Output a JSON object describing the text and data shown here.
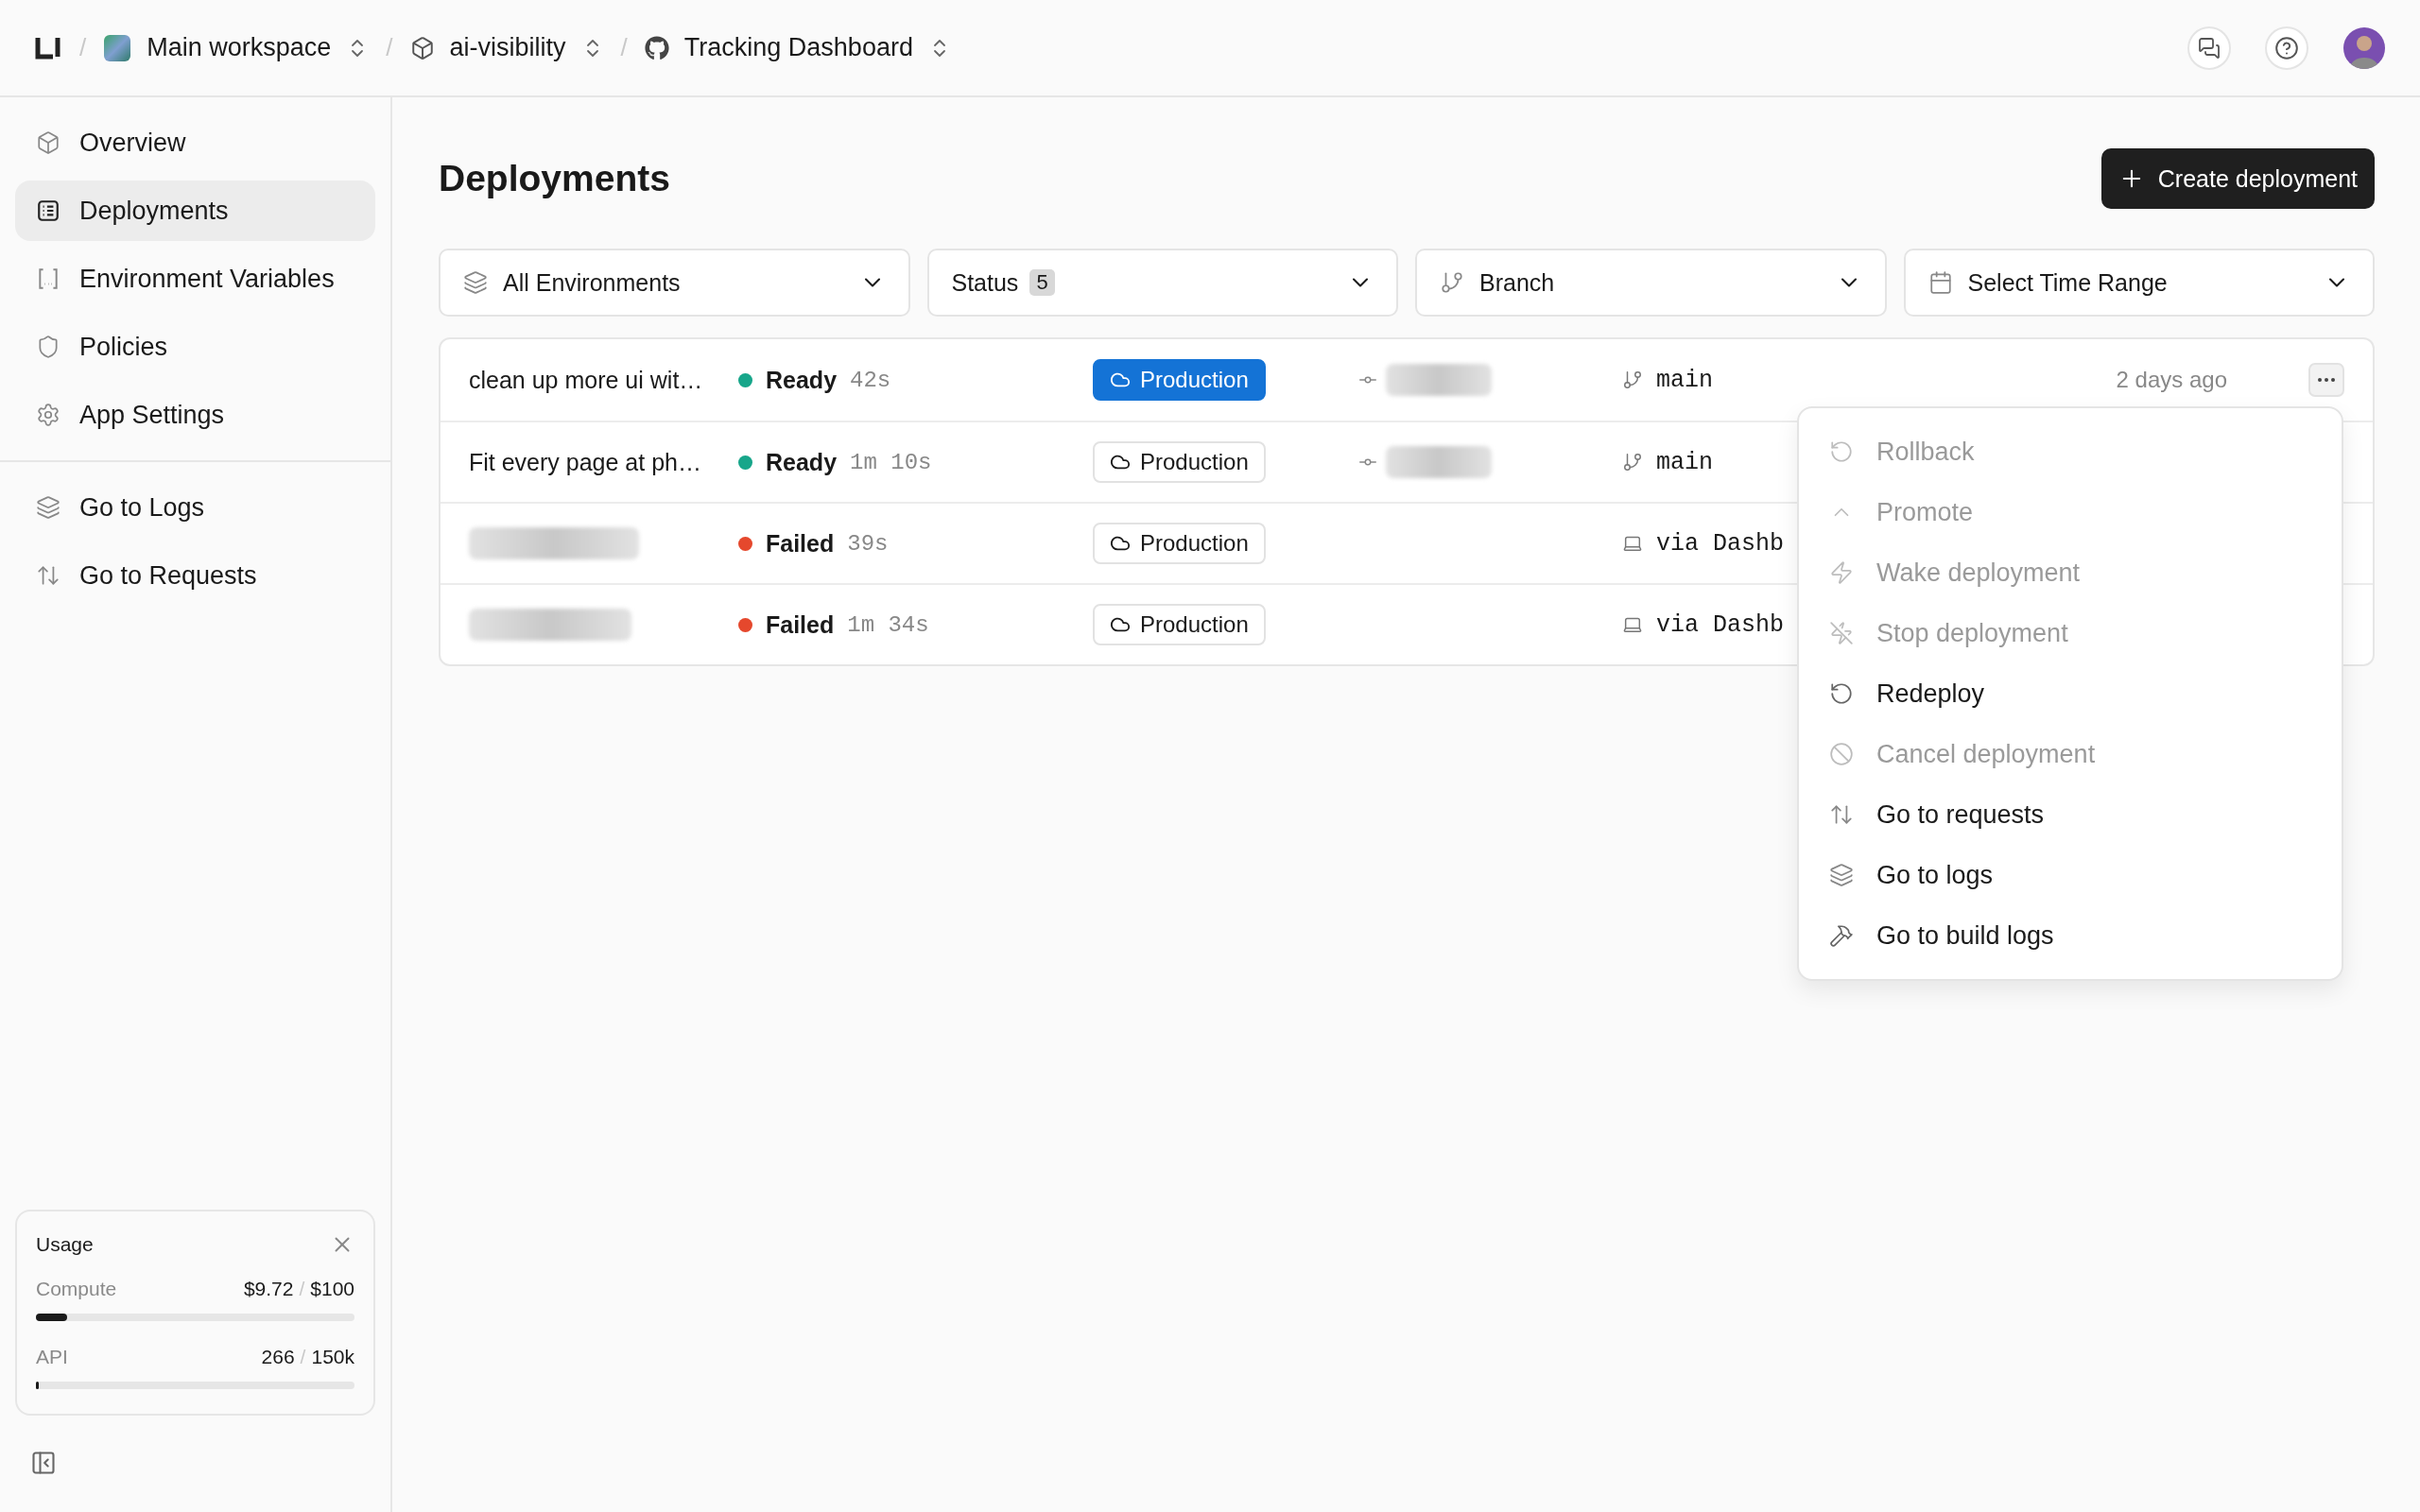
{
  "breadcrumbs": [
    {
      "kind": "workspace",
      "separator": "/",
      "label": "Main workspace"
    },
    {
      "kind": "project",
      "separator": "/",
      "label": "ai-visibility"
    },
    {
      "kind": "repo",
      "separator": "/",
      "label": "Tracking Dashboard"
    }
  ],
  "sidebar": {
    "items": [
      {
        "label": "Overview",
        "selected": false
      },
      {
        "label": "Deployments",
        "selected": true
      },
      {
        "label": "Environment Variables",
        "selected": false
      },
      {
        "label": "Policies",
        "selected": false
      },
      {
        "label": "App Settings",
        "selected": false
      }
    ],
    "links": [
      "Go to Logs",
      "Go to Requests"
    ],
    "usage": {
      "title": "Usage",
      "meters": [
        {
          "name": "Compute",
          "used": "$9.72",
          "separator": "/",
          "limit": "$100",
          "level": 0.0972
        },
        {
          "name": "API",
          "used": "266",
          "separator": "/",
          "limit": "150k",
          "level": 0.0018
        }
      ]
    }
  },
  "page": {
    "title": "Deployments",
    "create_button": "Create deployment"
  },
  "filters": [
    {
      "label": "All Environments"
    },
    {
      "label": "Status",
      "badge": "5"
    },
    {
      "label": "Branch"
    },
    {
      "label": "Select Time Range"
    }
  ],
  "deployments": [
    {
      "message": "clean up more ui wit…",
      "status": "Ready",
      "kind": "ready",
      "duration": "42s",
      "environment": "Production",
      "current": true,
      "commit_redacted": true,
      "source": {
        "kind": "branch",
        "text": "main"
      },
      "time": "2 days ago",
      "menu_open": true
    },
    {
      "message": "Fit every page at ph…",
      "status": "Ready",
      "kind": "ready",
      "duration": "1m 10s",
      "environment": "Production",
      "current": false,
      "commit_redacted": true,
      "source": {
        "kind": "branch",
        "text": "main"
      }
    },
    {
      "message_redacted": true,
      "status": "Failed",
      "kind": "failed",
      "duration": "39s",
      "environment": "Production",
      "current": false,
      "source": {
        "kind": "manual",
        "text": "via Dashb"
      }
    },
    {
      "message_redacted": true,
      "status": "Failed",
      "kind": "failed",
      "duration": "1m 34s",
      "environment": "Production",
      "current": false,
      "source": {
        "kind": "manual",
        "text": "via Dashb"
      }
    }
  ],
  "menu": [
    {
      "label": "Rollback",
      "disabled": true
    },
    {
      "label": "Promote",
      "disabled": true
    },
    {
      "label": "Wake deployment",
      "disabled": true
    },
    {
      "label": "Stop deployment",
      "disabled": true
    },
    {
      "label": "Redeploy",
      "disabled": false
    },
    {
      "label": "Cancel deployment",
      "disabled": true
    },
    {
      "label": "Go to requests",
      "disabled": false
    },
    {
      "label": "Go to logs",
      "disabled": false
    },
    {
      "label": "Go to build logs",
      "disabled": false
    }
  ]
}
